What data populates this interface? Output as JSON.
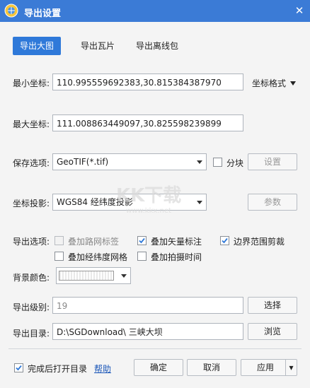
{
  "window": {
    "title": "导出设置",
    "close_glyph": "✕"
  },
  "tabs": [
    {
      "label": "导出大图",
      "active": true
    },
    {
      "label": "导出瓦片",
      "active": false
    },
    {
      "label": "导出离线包",
      "active": false
    }
  ],
  "min_coord": {
    "label": "最小坐标:",
    "value": "110.995559692383,30.815384387970",
    "format_label": "坐标格式"
  },
  "max_coord": {
    "label": "最大坐标:",
    "value": "111.008863449097,30.825598239899"
  },
  "save": {
    "label": "保存选项:",
    "selected": "GeoTIF(*.tif)",
    "tile_label": "分块",
    "tile_checked": false,
    "settings_label": "设置"
  },
  "projection": {
    "label": "坐标投影:",
    "selected": "WGS84 经纬度投影",
    "params_label": "参数"
  },
  "export_options": {
    "label": "导出选项:",
    "items": [
      {
        "label": "叠加路网标签",
        "checked": false,
        "disabled": true
      },
      {
        "label": "叠加矢量标注",
        "checked": true,
        "disabled": false
      },
      {
        "label": "边界范围剪裁",
        "checked": true,
        "disabled": false
      },
      {
        "label": "叠加经纬度网格",
        "checked": false,
        "disabled": false
      },
      {
        "label": "叠加拍摄时间",
        "checked": false,
        "disabled": false
      }
    ]
  },
  "background": {
    "label": "背景颜色:"
  },
  "level": {
    "label": "导出级别:",
    "value": "19",
    "choose_label": "选择"
  },
  "directory": {
    "label": "导出目录:",
    "value": "D:\\SGDownload\\ 三峡大坝",
    "browse_label": "浏览"
  },
  "footer": {
    "open_dir_label": "完成后打开目录",
    "open_dir_checked": true,
    "help_label": "帮助",
    "ok_label": "确定",
    "cancel_label": "取消",
    "apply_label": "应用",
    "apply_arrow": "▾"
  },
  "colors": {
    "titlebar": "#3b7bd6",
    "active_tab": "#2f79d9",
    "link": "#1a56b8",
    "check": "#2f79d9"
  }
}
